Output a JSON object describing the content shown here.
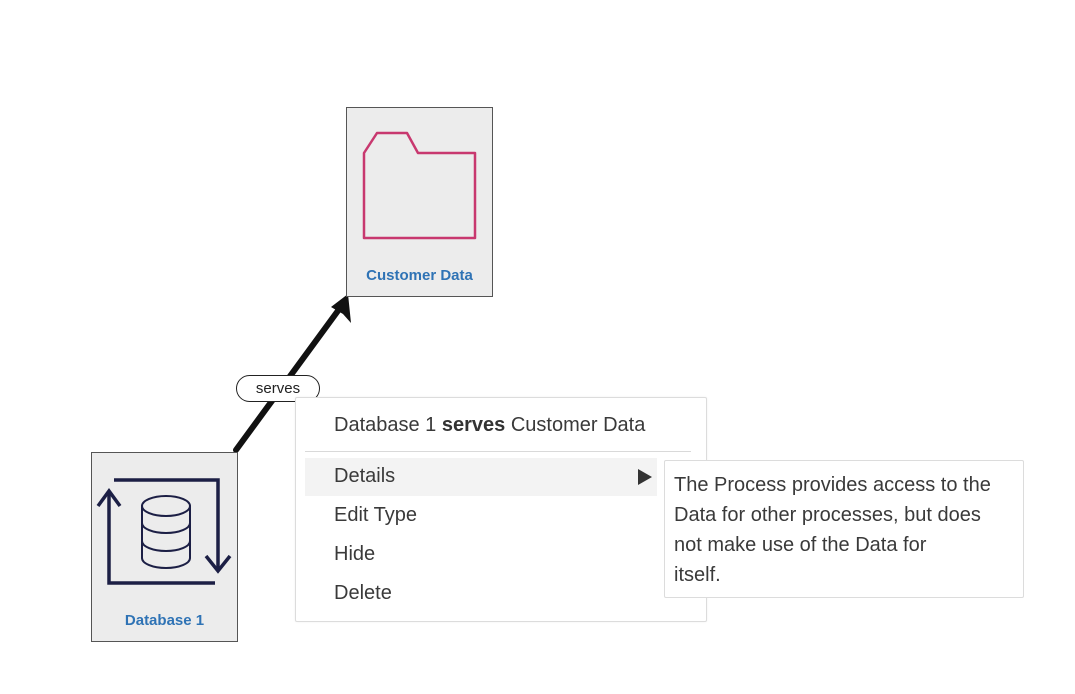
{
  "nodes": {
    "customer_data": {
      "label": "Customer Data",
      "icon": "folder-icon",
      "icon_color": "#c8386f"
    },
    "database_1": {
      "label": "Database 1",
      "icon": "database-sync-icon",
      "icon_color": "#1c1f45"
    }
  },
  "edge": {
    "label": "serves",
    "color": "#111111"
  },
  "context_menu": {
    "header": {
      "source": "Database 1",
      "relation": "serves",
      "target": "Customer Data"
    },
    "items": [
      {
        "label": "Details",
        "has_submenu": true,
        "active": true
      },
      {
        "label": "Edit Type"
      },
      {
        "label": "Hide"
      },
      {
        "label": "Delete"
      }
    ]
  },
  "tooltip": {
    "lines": [
      "The Process provides access to the",
      "Data for other processes, but does",
      "not make use of the Data for",
      "itself."
    ]
  },
  "colors": {
    "node_fill": "#ececec",
    "node_label": "#2f73b5",
    "menu_highlight": "#f3f3f3"
  }
}
